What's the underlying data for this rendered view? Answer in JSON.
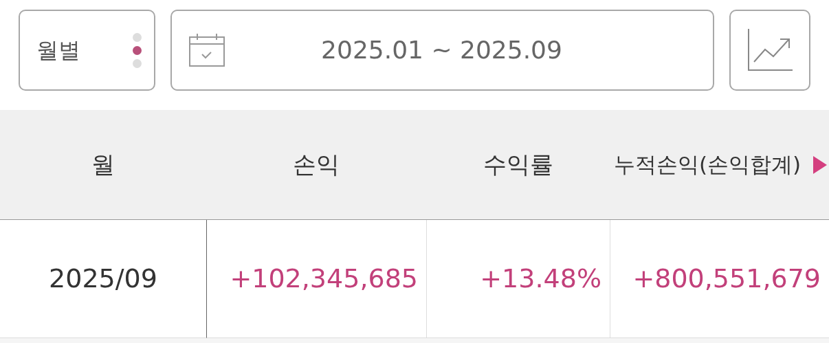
{
  "period_selector": {
    "label": "월별",
    "dots": [
      {
        "selected": false
      },
      {
        "selected": true
      },
      {
        "selected": false
      }
    ]
  },
  "date_range": {
    "value": "2025.01 ~ 2025.09"
  },
  "table": {
    "columns": [
      "월",
      "손익",
      "수익률",
      "누적손익(손익합계)"
    ],
    "rows": [
      {
        "cells": [
          "2025/09",
          "+102,345,685",
          "+13.48%",
          "+800,551,679"
        ]
      }
    ]
  }
}
